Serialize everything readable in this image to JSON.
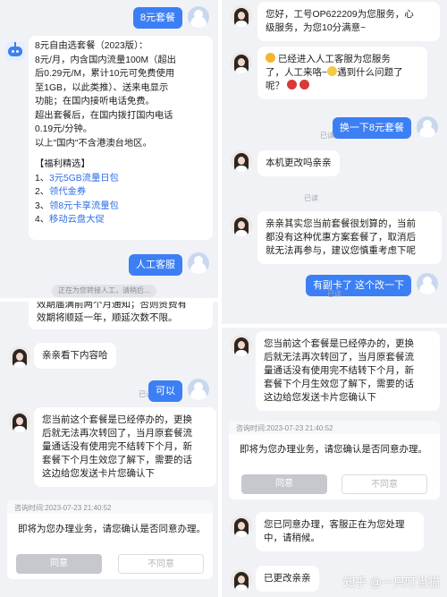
{
  "colors": {
    "accent": "#3c7ff4",
    "link": "#2e6ee8",
    "background": "#f1f2f6"
  },
  "icons": [
    "user-avatar-icon",
    "agent-avatar-icon",
    "robot-avatar-icon",
    "sun-emoji-icon",
    "rose-emoji-icon",
    "sweat-emoji-icon"
  ],
  "panel1": {
    "user_msg_1": "8元套餐",
    "bot_lines": [
      "8元自由选套餐（2023版）：",
      "8元/月，内含国内流量100M（超出",
      "后0.29元/M，累计10元可免费使用",
      "至1GB，以此类推）、送来电显示",
      "功能；在国内接听电话免费。",
      "超出套餐后，在国内拨打国内电话",
      "0.19元/分钟。",
      "以上\"国内\"不含港澳台地区。"
    ],
    "benefits_title": "【福利精选】",
    "benefits": [
      {
        "num": "1、",
        "text": "3元5GB流量日包"
      },
      {
        "num": "2、",
        "text": "领代金券"
      },
      {
        "num": "3、",
        "text": "领8元卡享流量包"
      },
      {
        "num": "4、",
        "text": "移动云盘大促"
      }
    ],
    "user_msg_2": "人工客服",
    "transfer_notice": "正在为您转接人工，请稍后..."
  },
  "panel2": {
    "agent_msg_1": [
      "您好，工号OP622209为您服务，心",
      "级服务，为您10分满意~"
    ],
    "agent_msg_2": [
      "已经进入人工客服为您服务",
      "了，人工来咯~",
      "遇到什么问题了",
      "呢？"
    ],
    "user_msg_1": "换一下8元套餐",
    "read_1": "已读",
    "agent_msg_3": "本机更改吗亲亲",
    "read_2": "已读",
    "agent_msg_4": [
      "亲亲其实您当前套餐很划算的，当前",
      "都没有这种优惠方案套餐了，取消后",
      "就无法再参与，建议您慎重考虑下呢"
    ],
    "user_msg_2": "有副卡了  这个改一下",
    "read_3": "已读"
  },
  "panel3": {
    "top_lines": [
      "效期届满前两个月通知；否则资费有",
      "效期将顺延一年，顺延次数不限。"
    ],
    "agent_msg_1": "亲亲看下内容哈",
    "read_1": "已读",
    "user_msg_1": "可以",
    "agent_msg_2": [
      "您当前这个套餐是已经停办的，更换",
      "后就无法再次转回了，当月原套餐流",
      "量通话没有使用完不结转下个月，新",
      "套餐下个月生效您了解下，需要的话",
      "这边给您发送卡片您确认下"
    ],
    "card": {
      "time": "咨询时间:2023-07-23 21:40:52",
      "message": "即将为您办理业务，请您确认是否同意办理。",
      "agree": "同意",
      "disagree": "不同意"
    }
  },
  "panel4": {
    "user_msg_1": "可以",
    "agent_msg_1": [
      "您当前这个套餐是已经停办的，更换",
      "后就无法再次转回了，当月原套餐流",
      "量通话没有使用完不结转下个月，新",
      "套餐下个月生效您了解下，需要的话",
      "这边给您发送卡片您确认下"
    ],
    "card": {
      "time": "咨询时间:2023-07-23 21:40:52",
      "message": "即将为您办理业务，请您确认是否同意办理。",
      "agree": "同意",
      "disagree": "不同意"
    },
    "agent_msg_2": [
      "您已同意办理，客服正在为您处理",
      "中，请稍候。"
    ],
    "agent_msg_3": "已更改亲亲",
    "watermark": "知乎 @一只叮当猫"
  }
}
